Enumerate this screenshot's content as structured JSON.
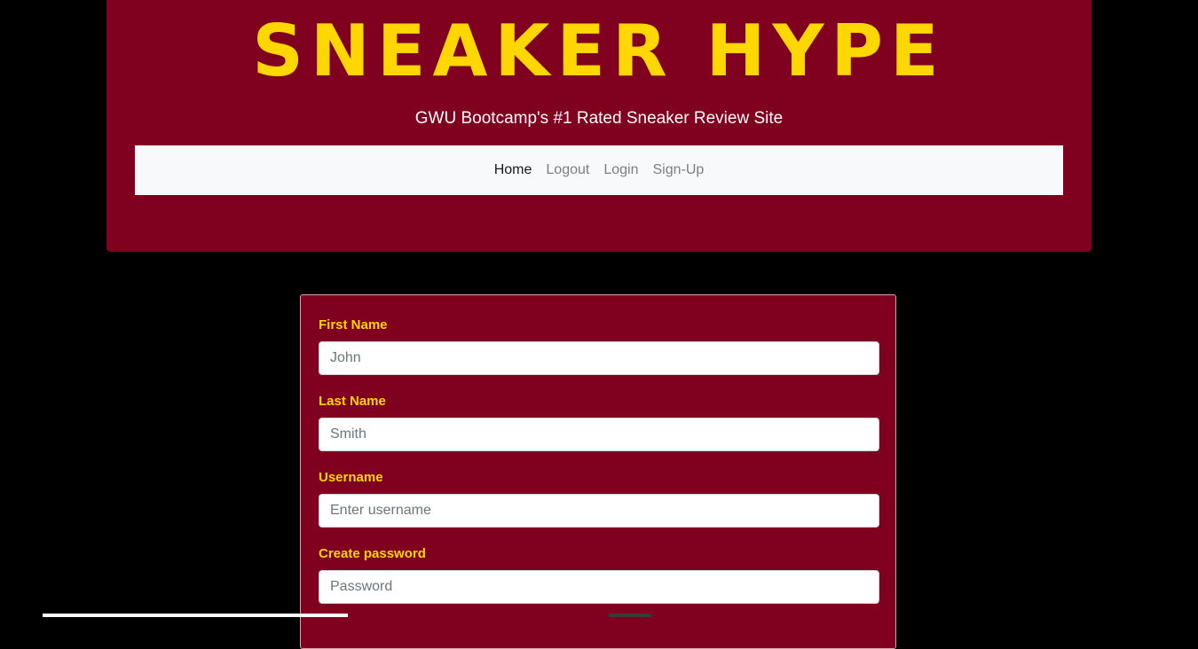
{
  "header": {
    "logo_text": "SNEAKER HYPE",
    "tagline": "GWU Bootcamp's #1 Rated Sneaker Review Site",
    "colors": {
      "background": "#800020",
      "logo": "#FFD700",
      "navbar": "#f8f9fa"
    }
  },
  "nav": {
    "items": [
      {
        "label": "Home",
        "active": true
      },
      {
        "label": "Logout",
        "active": false
      },
      {
        "label": "Login",
        "active": false
      },
      {
        "label": "Sign-Up",
        "active": false
      }
    ]
  },
  "form": {
    "fields": [
      {
        "label": "First Name",
        "placeholder": "John",
        "value": ""
      },
      {
        "label": "Last Name",
        "placeholder": "Smith",
        "value": ""
      },
      {
        "label": "Username",
        "placeholder": "Enter username",
        "value": ""
      },
      {
        "label": "Create password",
        "placeholder": "Password",
        "value": ""
      }
    ],
    "colors": {
      "background": "#800020",
      "label": "#FFD700"
    }
  }
}
